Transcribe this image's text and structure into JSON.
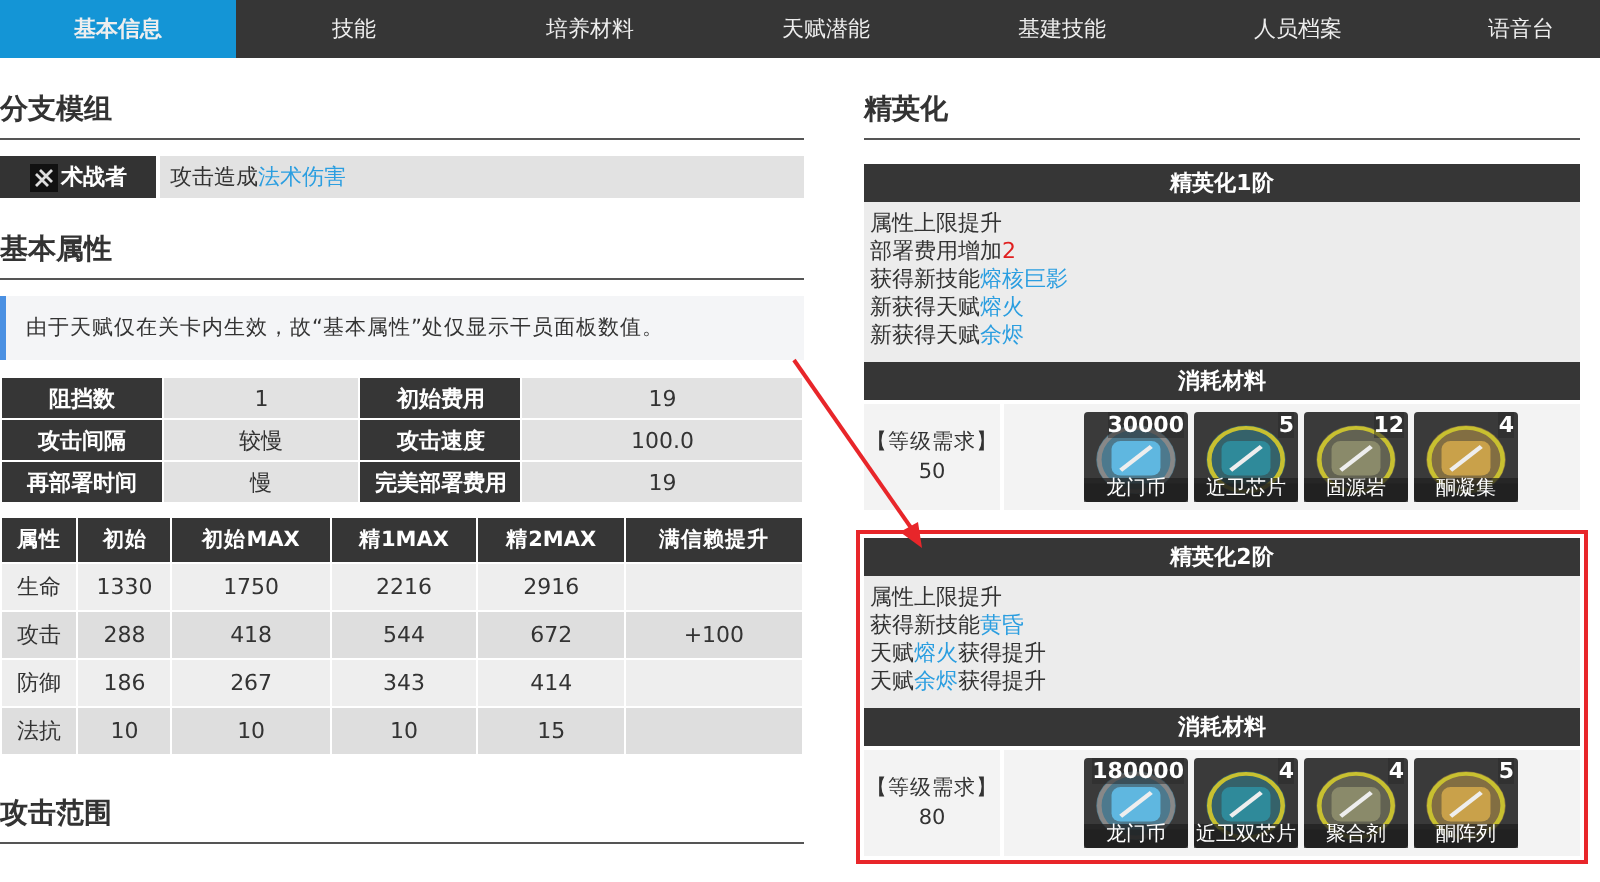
{
  "nav_tabs": [
    {
      "label": "基本信息",
      "selected": true
    },
    {
      "label": "技能",
      "selected": false
    },
    {
      "label": "培养材料",
      "selected": false
    },
    {
      "label": "天赋潜能",
      "selected": false
    },
    {
      "label": "基建技能",
      "selected": false
    },
    {
      "label": "人员档案",
      "selected": false
    },
    {
      "label": "语音台",
      "selected": false
    }
  ],
  "branch_module": {
    "heading": "分支模组",
    "badge": "术战者",
    "description": [
      {
        "text": "攻击造成",
        "kind": "plain"
      },
      {
        "text": "法术伤害",
        "kind": "link"
      }
    ]
  },
  "basic_attributes": {
    "heading": "基本属性",
    "note": "由于天赋仅在关卡内生效，故“基本属性”处仅显示干员面板数值。",
    "info_rows": [
      [
        "阻挡数",
        "1",
        "初始费用",
        "19"
      ],
      [
        "攻击间隔",
        "较慢",
        "攻击速度",
        "100.0"
      ],
      [
        "再部署时间",
        "慢",
        "完美部署费用",
        "19"
      ]
    ],
    "stat_columns": [
      "属性",
      "初始",
      "初始MAX",
      "精1MAX",
      "精2MAX",
      "满信赖提升"
    ],
    "stat_rows": [
      [
        "生命",
        "1330",
        "1750",
        "2216",
        "2916",
        ""
      ],
      [
        "攻击",
        "288",
        "418",
        "544",
        "672",
        "+100"
      ],
      [
        "防御",
        "186",
        "267",
        "343",
        "414",
        ""
      ],
      [
        "法抗",
        "10",
        "10",
        "10",
        "15",
        ""
      ]
    ]
  },
  "attack_range": {
    "heading": "攻击范围"
  },
  "elite": {
    "heading": "精英化",
    "stages": [
      {
        "title": "精英化1阶",
        "highlighted": false,
        "effects": [
          [
            {
              "text": "属性上限提升",
              "kind": "plain"
            }
          ],
          [
            {
              "text": "部署费用增加",
              "kind": "plain"
            },
            {
              "text": "2",
              "kind": "number"
            }
          ],
          [
            {
              "text": "获得新技能",
              "kind": "plain"
            },
            {
              "text": "熔核巨影",
              "kind": "link"
            }
          ],
          [
            {
              "text": "新获得天赋",
              "kind": "plain"
            },
            {
              "text": "熔火",
              "kind": "link"
            }
          ],
          [
            {
              "text": "新获得天赋",
              "kind": "plain"
            },
            {
              "text": "余烬",
              "kind": "link"
            }
          ]
        ],
        "materials_title": "消耗材料",
        "level_label": "【等级需求】",
        "level": "50",
        "materials": [
          {
            "count": "30000",
            "name": "龙门币"
          },
          {
            "count": "5",
            "name": "近卫芯片"
          },
          {
            "count": "12",
            "name": "固源岩"
          },
          {
            "count": "4",
            "name": "酮凝集"
          }
        ]
      },
      {
        "title": "精英化2阶",
        "highlighted": true,
        "effects": [
          [
            {
              "text": "属性上限提升",
              "kind": "plain"
            }
          ],
          [
            {
              "text": "获得新技能",
              "kind": "plain"
            },
            {
              "text": "黄昏",
              "kind": "link"
            }
          ],
          [
            {
              "text": "天赋",
              "kind": "plain"
            },
            {
              "text": "熔火",
              "kind": "link"
            },
            {
              "text": "获得提升",
              "kind": "plain"
            }
          ],
          [
            {
              "text": "天赋",
              "kind": "plain"
            },
            {
              "text": "余烬",
              "kind": "link"
            },
            {
              "text": "获得提升",
              "kind": "plain"
            }
          ]
        ],
        "materials_title": "消耗材料",
        "level_label": "【等级需求】",
        "level": "80",
        "materials": [
          {
            "count": "180000",
            "name": "龙门币"
          },
          {
            "count": "4",
            "name": "近卫双芯片"
          },
          {
            "count": "4",
            "name": "聚合剂"
          },
          {
            "count": "5",
            "name": "酮阵列"
          }
        ]
      }
    ]
  }
}
